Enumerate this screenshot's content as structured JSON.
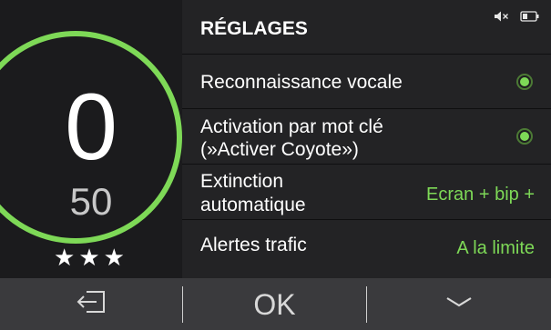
{
  "speed": {
    "current": "0",
    "limit": "50",
    "rating": "★★★",
    "ring_color": "#7ed957"
  },
  "status_icons": [
    "mute-icon",
    "battery-icon"
  ],
  "settings": {
    "title": "RÉGLAGES",
    "rows": [
      {
        "label": "Reconnaissance vocale",
        "control": "radio",
        "selected": true
      },
      {
        "label_line1": "Activation par mot clé",
        "label_line2": "(»Activer Coyote»)",
        "control": "radio",
        "selected": true
      },
      {
        "label_line1": "Extinction",
        "label_line2": "automatique",
        "value": "Ecran + bip +"
      },
      {
        "label": "Alertes trafic",
        "value": "A la limite"
      }
    ]
  },
  "bottom_bar": {
    "back_icon": "exit-arrow-icon",
    "ok_label": "OK",
    "down_icon": "chevron-down-icon"
  },
  "colors": {
    "accent": "#7ed957",
    "panel": "#232325",
    "background": "#1b1b1d",
    "bar": "#3a3a3d"
  }
}
